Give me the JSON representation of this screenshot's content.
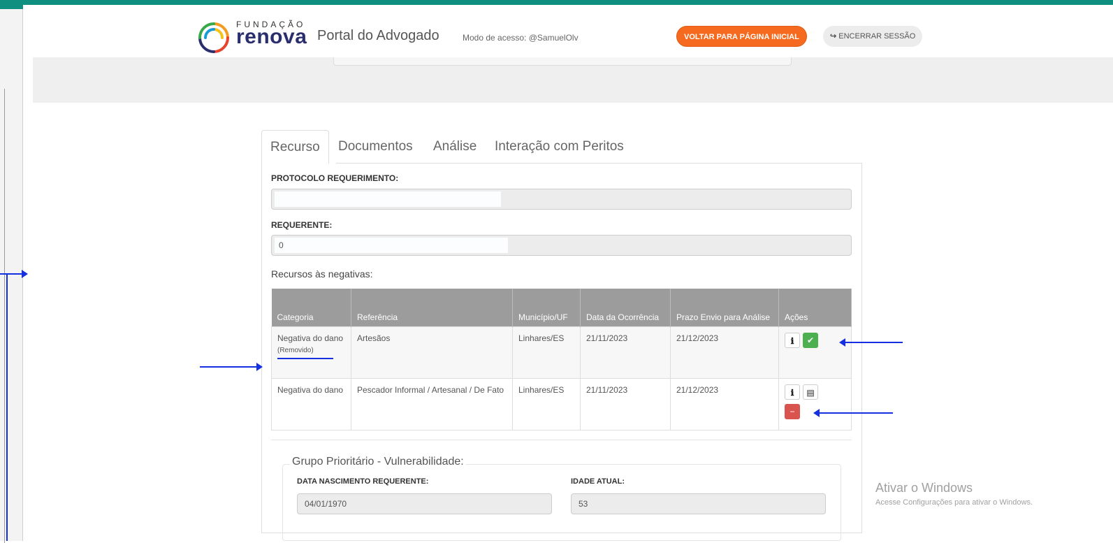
{
  "header": {
    "brand_top": "FUNDAÇÃO",
    "brand_main": "renova",
    "portal_title": "Portal do Advogado",
    "access_text": "Modo de acesso: @SamuelOlv",
    "back_button": "VOLTAR PARA PÁGINA INICIAL",
    "logout_button": "ENCERRAR SESSÃO"
  },
  "tabs": [
    {
      "label": "Recurso",
      "active": true
    },
    {
      "label": "Documentos",
      "active": false
    },
    {
      "label": "Análise",
      "active": false
    },
    {
      "label": "Interação com Peritos",
      "active": false
    }
  ],
  "form": {
    "protocolo_label": "PROTOCOLO REQUERIMENTO:",
    "protocolo_value": "",
    "requerente_label": "REQUERENTE:",
    "requerente_value": "0"
  },
  "appeals": {
    "title": "Recursos às negativas:",
    "columns": [
      "Categoria",
      "Referência",
      "Município/UF",
      "Data da Ocorrência",
      "Prazo Envio para Análise",
      "Ações"
    ],
    "rows": [
      {
        "categoria": "Negativa do dano",
        "status": "(Removido)",
        "referencia": "Artesãos",
        "municipio": "Linhares/ES",
        "data": "21/11/2023",
        "prazo": "21/12/2023",
        "actions": [
          "info-icon",
          "check-icon"
        ]
      },
      {
        "categoria": "Negativa do dano",
        "status": "",
        "referencia": "Pescador Informal / Artesanal / De Fato",
        "municipio": "Linhares/ES",
        "data": "21/11/2023",
        "prazo": "21/12/2023",
        "actions": [
          "info-icon",
          "folder-open-icon",
          "minus-circle-icon"
        ]
      }
    ]
  },
  "priority": {
    "legend": "Grupo Prioritário - Vulnerabilidade:",
    "birth_label": "DATA NASCIMENTO REQUERENTE:",
    "birth_value": "04/01/1970",
    "age_label": "IDADE ATUAL:",
    "age_value": "53"
  },
  "watermark": {
    "line1": "Ativar o Windows",
    "line2": "Acesse Configurações para ativar o Windows."
  },
  "colors": {
    "top_bar": "#0f8f7f",
    "back_button": "#f56a1f",
    "table_header": "#9c9c9c",
    "ok_action": "#4cb050",
    "remove_action": "#d9534f",
    "annotation_arrow": "#1530e0"
  }
}
